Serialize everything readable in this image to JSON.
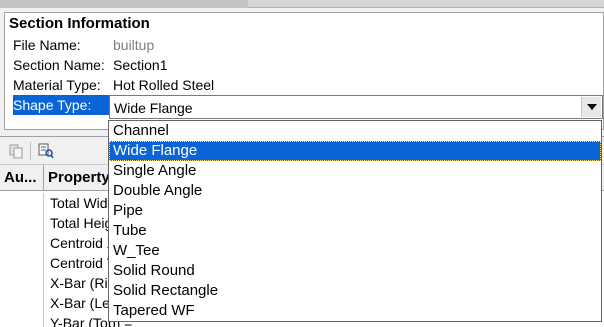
{
  "section": {
    "header": "Section Information",
    "rows": [
      {
        "label": "File Name:",
        "value": "builtup"
      },
      {
        "label": "Section Name:",
        "value": "Section1"
      },
      {
        "label": "Material Type:",
        "value": "Hot Rolled Steel"
      },
      {
        "label": "Shape Type:",
        "value": "Wide Flange"
      }
    ]
  },
  "dropdown": {
    "options": [
      "Channel",
      "Wide Flange",
      "Single Angle",
      "Double Angle",
      "Pipe",
      "Tube",
      "W_Tee",
      "Solid Round",
      "Solid Rectangle",
      "Tapered WF"
    ],
    "selected": "Wide Flange"
  },
  "grid": {
    "columns": [
      "Au...",
      "Property"
    ],
    "rows": [
      "Total Width =",
      "Total Height =",
      "Centroid X =",
      "Centroid Y =",
      "X-Bar (Right) =",
      "X-Bar (Left) =",
      "Y-Bar (Top) ="
    ]
  },
  "icons": {
    "copy": "copy-icon",
    "find": "find-icon",
    "combo_arrow": "chevron-down-icon"
  },
  "colors": {
    "selection": "#0a64d6"
  }
}
